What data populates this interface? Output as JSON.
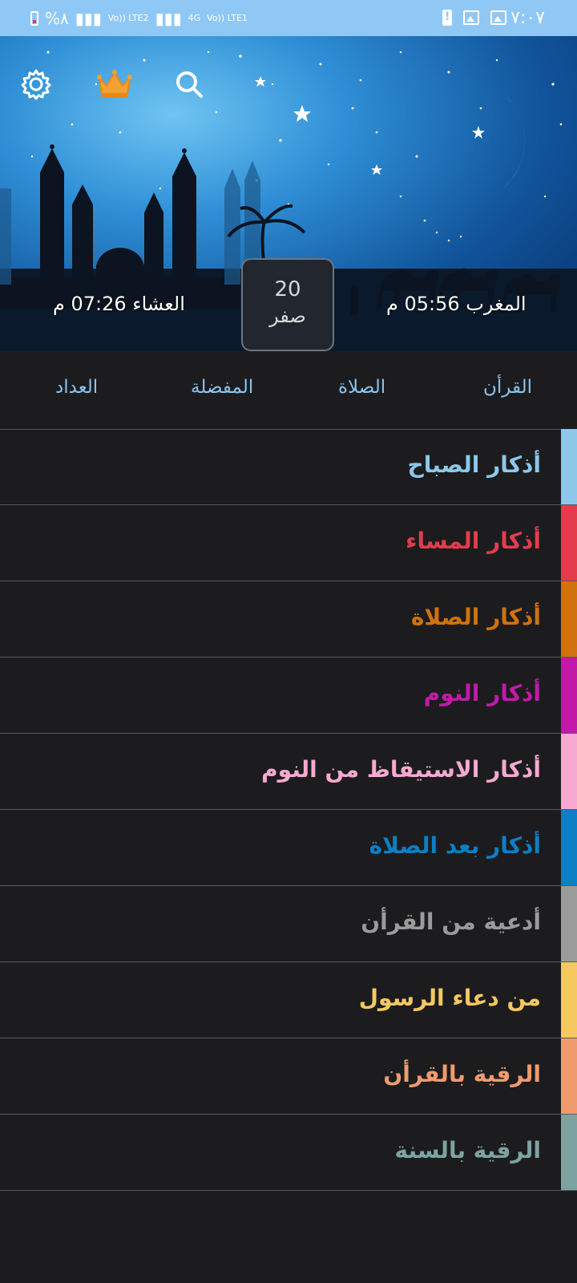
{
  "status_bar": {
    "battery_percent": "%٨",
    "network_labels": [
      "Vo)) LTE2",
      "4G",
      "Vo)) LTE1"
    ],
    "time": "٧:٠٧"
  },
  "header": {
    "icons": [
      "settings-icon",
      "crown-icon",
      "search-icon"
    ],
    "hijri_date": {
      "day": "20",
      "month": "صفر"
    },
    "prayer_left": "العشاء 07:26 م",
    "prayer_right": "المغرب 05:56 م"
  },
  "tabs": [
    {
      "label": "القرأن"
    },
    {
      "label": "الصلاة"
    },
    {
      "label": "المفضلة"
    },
    {
      "label": "العداد"
    }
  ],
  "adhkar_list": [
    {
      "label": "أذكار الصباح",
      "color": "#8cc8ea"
    },
    {
      "label": "أذكار المساء",
      "color": "#e43c4c"
    },
    {
      "label": "أذكار الصلاة",
      "color": "#d0720e"
    },
    {
      "label": "أذكار النوم",
      "color": "#c21aa8"
    },
    {
      "label": "أذكار الاستيقاظ من النوم",
      "color": "#f7a9cf"
    },
    {
      "label": "أذكار بعد الصلاة",
      "color": "#0d7fc4"
    },
    {
      "label": "أدعية من القرأن",
      "color": "#9b9b9b"
    },
    {
      "label": "من دعاء الرسول",
      "color": "#f5c860"
    },
    {
      "label": "الرقية بالقرأن",
      "color": "#ef9b6e"
    },
    {
      "label": "الرقية بالسنة",
      "color": "#7da3a0"
    }
  ]
}
